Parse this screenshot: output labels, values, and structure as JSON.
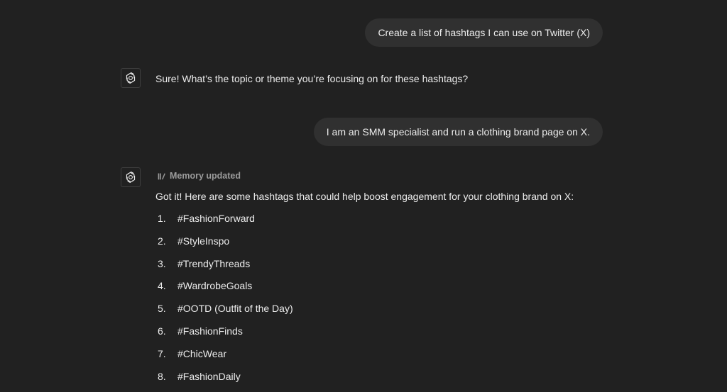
{
  "messages": {
    "user_1": "Create a list of hashtags I can use on Twitter (X)",
    "assistant_1": "Sure! What’s the topic or theme you’re focusing on for these hashtags?",
    "user_2": "I am an SMM specialist and run a clothing brand page on X.",
    "assistant_2": {
      "memory_status": "Memory updated",
      "intro": "Got it! Here are some hashtags that could help boost engagement for your clothing brand on X:",
      "hashtags": [
        {
          "num": "1.",
          "tag": "#FashionForward"
        },
        {
          "num": "2.",
          "tag": "#StyleInspo"
        },
        {
          "num": "3.",
          "tag": "#TrendyThreads"
        },
        {
          "num": "4.",
          "tag": "#WardrobeGoals"
        },
        {
          "num": "5.",
          "tag": "#OOTD (Outfit of the Day)"
        },
        {
          "num": "6.",
          "tag": "#FashionFinds"
        },
        {
          "num": "7.",
          "tag": "#ChicWear"
        },
        {
          "num": "8.",
          "tag": "#FashionDaily"
        }
      ]
    }
  },
  "icons": {
    "assistant_avatar": "openai-logo-icon",
    "memory": "memory-edit-icon"
  },
  "colors": {
    "background": "#212121",
    "user_bubble": "#303030",
    "text": "#ececec",
    "muted_text": "#9b9b9b"
  }
}
